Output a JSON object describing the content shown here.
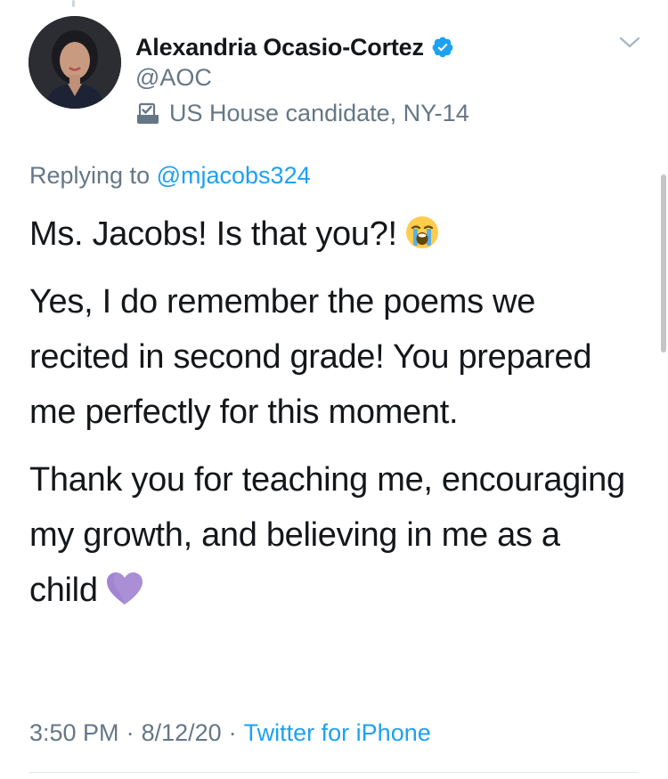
{
  "author": {
    "name": "Alexandria Ocasio-Cortez",
    "handle": "@AOC",
    "label": "US House candidate, NY-14",
    "verified": true,
    "avatar_icon": "profile-photo"
  },
  "reply": {
    "prefix": "Replying to",
    "mention": "@mjacobs324"
  },
  "tweet": {
    "paragraphs": [
      "Ms. Jacobs! Is that you?!",
      "Yes, I do remember the poems we recited in second grade! You prepared me perfectly for this moment.",
      "Thank you for teaching me, encouraging my growth, and believing in me as a child"
    ],
    "emojis": [
      "loudly-crying-face",
      "purple-heart"
    ]
  },
  "meta": {
    "time": "3:50 PM",
    "date": "8/12/20",
    "separator": "·",
    "source": "Twitter for iPhone"
  },
  "colors": {
    "accent": "#1da1f2",
    "secondary_text": "#657786",
    "primary_text": "#14171a",
    "divider": "#e1e8ed"
  }
}
